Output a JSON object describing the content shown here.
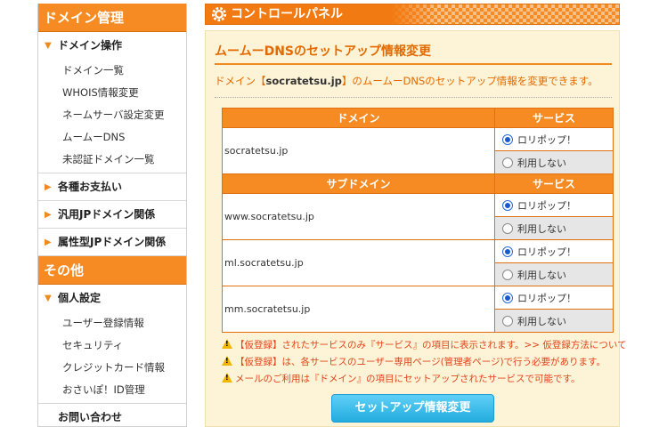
{
  "sidebar": {
    "domain_head": "ドメイン管理",
    "domain_ops": "ドメイン操作",
    "domain_items": [
      "ドメイン一覧",
      "WHOIS情報変更",
      "ネームサーバ設定変更",
      "ムームーDNS",
      "未認証ドメイン一覧"
    ],
    "payments": "各種お支払い",
    "general_jp": "汎用JPドメイン関係",
    "attr_jp": "属性型JPドメイン関係",
    "other_head": "その他",
    "personal": "個人設定",
    "personal_items": [
      "ユーザー登録情報",
      "セキュリティ",
      "クレジットカード情報",
      "おさいぽ！ID管理"
    ],
    "contact": "お問い合わせ"
  },
  "header": {
    "title": "コントロールパネル",
    "icon": "gear-icon"
  },
  "panel": {
    "title": "ムームーDNSのセットアップ情報変更",
    "desc_pre": "ドメイン【",
    "desc_domain": "socratetsu.jp",
    "desc_post": "】のムームーDNSのセットアップ情報を変更できます。"
  },
  "table": {
    "col_domain": "ドメイン",
    "col_service": "サービス",
    "col_subdomain": "サブドメイン",
    "opt_lolipop": "ロリポップ！",
    "opt_none": "利用しない",
    "domain_name": "socratetsu.jp",
    "subdomains": [
      "www.socratetsu.jp",
      "ml.socratetsu.jp",
      "mm.socratetsu.jp"
    ]
  },
  "notes": [
    "【仮登録】されたサービスのみ『サービス』の項目に表示されます。>> 仮登録方法について",
    "【仮登録】は、各サービスのユーザー専用ページ(管理者ページ)で行う必要があります。",
    "メールのご利用は『ドメイン』の項目にセットアップされたサービスで可能です。"
  ],
  "submit_label": "セットアップ情報変更",
  "colors": {
    "accent": "#f58b22",
    "note": "#e2441a",
    "panel_bg": "#fdf3d6",
    "button": "#22acde"
  }
}
